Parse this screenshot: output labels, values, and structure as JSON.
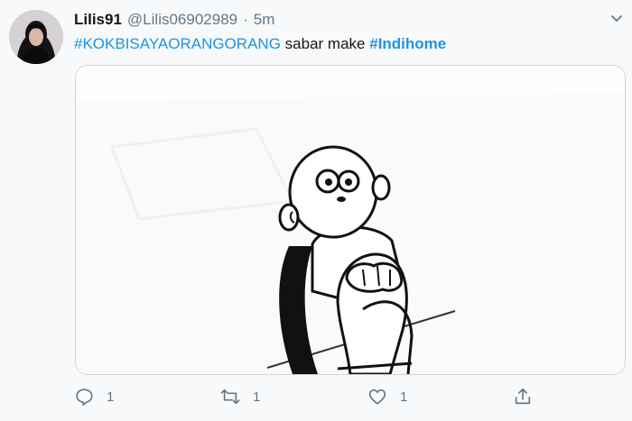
{
  "tweet": {
    "display_name": "Lilis91",
    "handle": "@Lilis06902989",
    "separator": "·",
    "time": "5m",
    "text_plain": "sabar make",
    "hashtag_1": "#KOKBISAYAORANGORANG",
    "hashtag_2": "#Indihome"
  },
  "actions": {
    "reply_count": "1",
    "retweet_count": "1",
    "like_count": "1"
  },
  "colors": {
    "hashtag": "#1b95e0",
    "muted": "#657786",
    "background": "#f7f9fa"
  },
  "icons": [
    "chevron-down-icon",
    "reply-icon",
    "retweet-icon",
    "like-icon",
    "share-icon"
  ]
}
